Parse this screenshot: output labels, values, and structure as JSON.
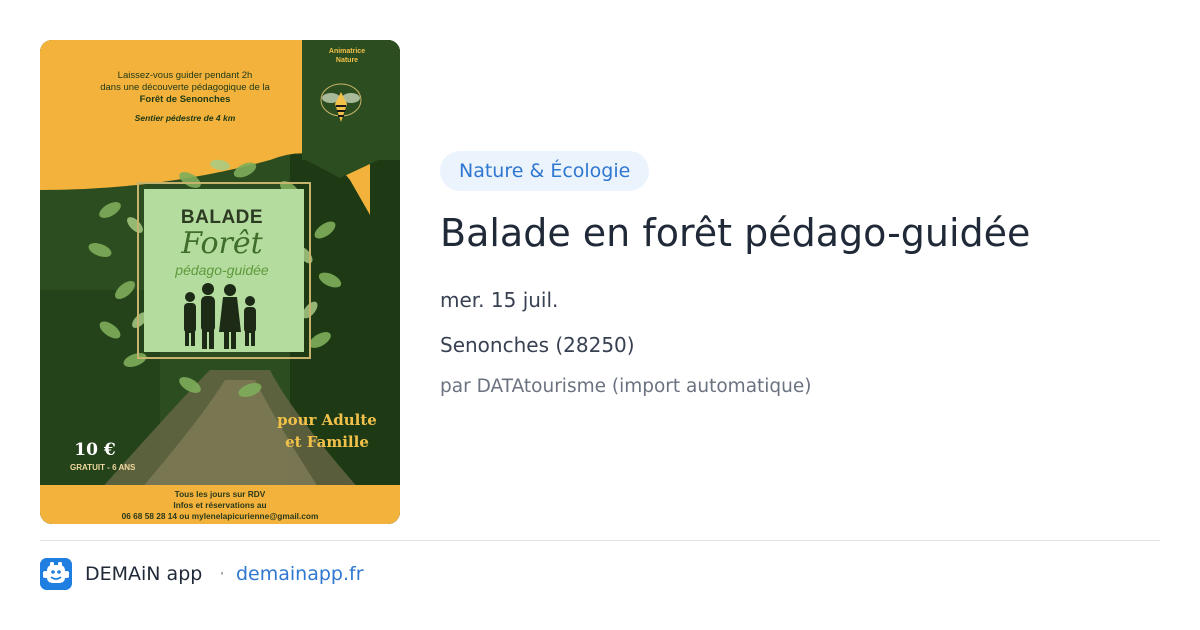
{
  "poster": {
    "intro_line1": "Laissez-vous guider pendant 2h",
    "intro_line2": "dans une découverte pédagogique de la",
    "intro_forest": "Forêt de Senonches",
    "trail": "Sentier pédestre de 4 km",
    "animator_line1": "Animatrice",
    "animator_line2": "Nature",
    "title_line1": "BALADE",
    "title_line2": "Forêt",
    "title_line3": "pédago-guidée",
    "public_line1": "pour Adulte",
    "public_line2": "et Famille",
    "price": "10 €",
    "free": "GRATUIT - 6 ANS",
    "footer_line1": "Tous les jours sur RDV",
    "footer_line2": "Infos et réservations au",
    "footer_line3": "06 68 58 28 14  ou mylenelapicurienne@gmail.com",
    "colors": {
      "green": "#2b4d1f",
      "yellow": "#f2b23c"
    }
  },
  "event": {
    "category": "Nature & Écologie",
    "title": "Balade en forêt pédago-guidée",
    "date": "mer. 15 juil.",
    "location": "Senonches (28250)",
    "source": "par DATAtourisme (import automatique)"
  },
  "brand": {
    "icon": "demain-app-logo-icon",
    "name": "DEMAiN app",
    "separator": "·",
    "url": "demainapp.fr"
  },
  "colors": {
    "accent": "#2f77d0",
    "tag_bg": "#ebf3fd",
    "text": "#1f2937",
    "muted": "#6b7280"
  }
}
